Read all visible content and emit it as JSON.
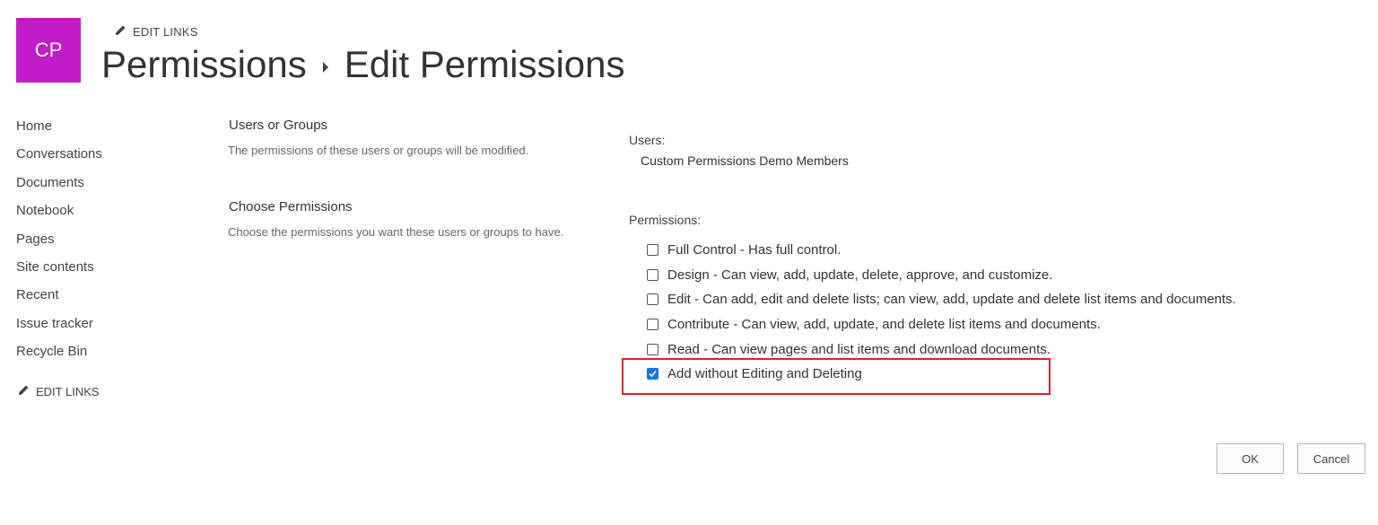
{
  "header": {
    "logo_text": "CP",
    "logo_color": "#c21cc8",
    "edit_links": "EDIT LINKS",
    "breadcrumb_parent": "Permissions",
    "breadcrumb_current": "Edit Permissions"
  },
  "nav": {
    "items": [
      {
        "label": "Home"
      },
      {
        "label": "Conversations"
      },
      {
        "label": "Documents"
      },
      {
        "label": "Notebook"
      },
      {
        "label": "Pages"
      },
      {
        "label": "Site contents"
      },
      {
        "label": "Recent"
      },
      {
        "label": "Issue tracker"
      },
      {
        "label": "Recycle Bin"
      }
    ],
    "edit_links": "EDIT LINKS"
  },
  "sections": {
    "users_groups": {
      "title": "Users or Groups",
      "description": "The permissions of these users or groups will be modified."
    },
    "choose_permissions": {
      "title": "Choose Permissions",
      "description": "Choose the permissions you want these users or groups to have."
    }
  },
  "form": {
    "users_label": "Users:",
    "users_value": "Custom Permissions Demo Members",
    "permissions_label": "Permissions:",
    "permissions": [
      {
        "label": "Full Control - Has full control.",
        "checked": false
      },
      {
        "label": "Design - Can view, add, update, delete, approve, and customize.",
        "checked": false
      },
      {
        "label": "Edit - Can add, edit and delete lists; can view, add, update and delete list items and documents.",
        "checked": false
      },
      {
        "label": "Contribute - Can view, add, update, and delete list items and documents.",
        "checked": false
      },
      {
        "label": "Read - Can view pages and list items and download documents.",
        "checked": false
      },
      {
        "label": "Add without Editing and Deleting",
        "checked": true
      }
    ],
    "highlight_color": "#e0202a"
  },
  "buttons": {
    "ok": "OK",
    "cancel": "Cancel"
  },
  "colors": {
    "accent": "#1a73e8"
  }
}
